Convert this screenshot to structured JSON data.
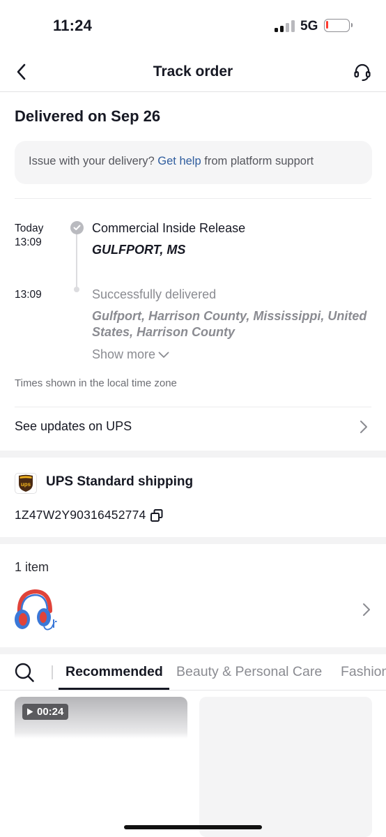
{
  "status_bar": {
    "time": "11:24",
    "network": "5G"
  },
  "nav": {
    "title": "Track order",
    "back_icon": "chevron-left-icon",
    "support_icon": "headset-icon"
  },
  "delivery": {
    "title": "Delivered on Sep 26",
    "help_prefix": "Issue with your delivery?",
    "help_link": "Get help",
    "help_suffix": "from platform support"
  },
  "timeline": [
    {
      "date": "Today",
      "time": "13:09",
      "status": "Commercial Inside Release",
      "location": "GULFPORT, MS"
    },
    {
      "time": "13:09",
      "status": "Successfully delivered",
      "location": "Gulfport, Harrison County, Mississippi, United States, Harrison County"
    }
  ],
  "show_more": "Show more",
  "timezone_note": "Times shown in the local time zone",
  "carrier_link": "See updates on UPS",
  "shipping": {
    "logo_text": "ups",
    "method": "UPS Standard shipping",
    "tracking_number": "1Z47W2Y90316452774"
  },
  "items": {
    "count_label": "1 item"
  },
  "tabs": [
    "Recommended",
    "Beauty & Personal Care",
    "Fashion"
  ],
  "feed": {
    "video_duration": "00:24"
  },
  "colors": {
    "link": "#2f5d9e",
    "ups_brown": "#4b2a12",
    "ups_gold": "#f4b51d",
    "battery_low": "#ff3b30"
  }
}
